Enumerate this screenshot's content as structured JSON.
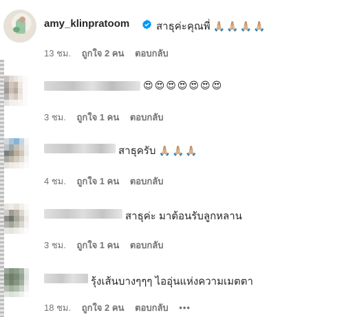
{
  "comments": [
    {
      "username": "amy_klinpratoom",
      "verified": true,
      "text": "สาธุค่ะคุณพี่",
      "emoji": "🙏🏼🙏🏼🙏🏼🙏🏼",
      "time": "13 ชม.",
      "likes": "ถูกใจ 2 คน",
      "reply": "ตอบกลับ"
    },
    {
      "text": "",
      "emoji": "😍😍😍😍😍😍😍",
      "time": "3 ชม.",
      "likes": "ถูกใจ 1 คน",
      "reply": "ตอบกลับ"
    },
    {
      "text": "สาธุครับ",
      "emoji": "🙏🏼🙏🏼🙏🏼",
      "time": "4 ชม.",
      "likes": "ถูกใจ 1 คน",
      "reply": "ตอบกลับ"
    },
    {
      "text": "สาธุค่ะ มาต้อนรับลูกหลาน",
      "emoji": "",
      "time": "3 ชม.",
      "likes": "ถูกใจ 1 คน",
      "reply": "ตอบกลับ"
    },
    {
      "text": "รุ้งเส้นบางๆๆๆ ไออุ่นแห่งความเมตตา",
      "emoji": "",
      "time": "18 ชม.",
      "likes": "ถูกใจ 2 คน",
      "reply": "ตอบกลับ",
      "more": "•••"
    }
  ],
  "icons": {
    "verified": "verified-badge-icon",
    "more": "more-options-icon"
  },
  "colors": {
    "verified": "#0095f6",
    "meta": "#737373",
    "text": "#262626"
  }
}
